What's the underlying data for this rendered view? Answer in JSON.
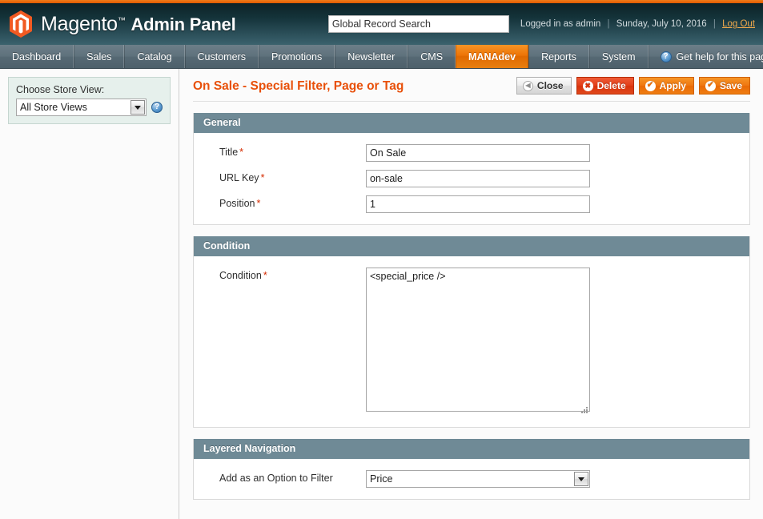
{
  "brand": {
    "logo_icon": "magento-hexagon-logo-icon",
    "name_light": "Magento",
    "trademark": "™",
    "name_bold": "Admin Panel",
    "accent_orange": "#e96300",
    "header_dark": "#14333a"
  },
  "header": {
    "search_placeholder": "Global Record Search",
    "search_value": "Global Record Search",
    "logged_in_as": "Logged in as admin",
    "separator": "|",
    "date": "Sunday, July 10, 2016",
    "logout_label": "Log Out"
  },
  "nav": {
    "items": [
      {
        "label": "Dashboard",
        "active": false
      },
      {
        "label": "Sales",
        "active": false
      },
      {
        "label": "Catalog",
        "active": false
      },
      {
        "label": "Customers",
        "active": false
      },
      {
        "label": "Promotions",
        "active": false
      },
      {
        "label": "Newsletter",
        "active": false
      },
      {
        "label": "CMS",
        "active": false
      },
      {
        "label": "MANAdev",
        "active": true
      },
      {
        "label": "Reports",
        "active": false
      },
      {
        "label": "System",
        "active": false
      }
    ],
    "help_icon": "help-circle-icon",
    "help_label": "Get help for this page"
  },
  "sidebar": {
    "store_switcher": {
      "label": "Choose Store View:",
      "selected": "All Store Views",
      "help_icon": "help-circle-icon"
    }
  },
  "content": {
    "page_title": "On Sale - Special Filter, Page or Tag",
    "buttons": [
      {
        "label": "Close",
        "style": "gray",
        "icon": "back-arrow-circle-icon"
      },
      {
        "label": "Delete",
        "style": "red",
        "icon": "x-circle-icon"
      },
      {
        "label": "Apply",
        "style": "orange",
        "icon": "check-circle-icon"
      },
      {
        "label": "Save",
        "style": "orange",
        "icon": "check-circle-icon"
      }
    ],
    "fieldsets": [
      {
        "legend": "General",
        "fields": [
          {
            "label": "Title",
            "required": true,
            "type": "text",
            "value": "On Sale"
          },
          {
            "label": "URL Key",
            "required": true,
            "type": "text",
            "value": "on-sale"
          },
          {
            "label": "Position",
            "required": true,
            "type": "text",
            "value": "1"
          }
        ]
      },
      {
        "legend": "Condition",
        "fields": [
          {
            "label": "Condition",
            "required": true,
            "type": "textarea",
            "value": "<special_price />"
          }
        ]
      },
      {
        "legend": "Layered Navigation",
        "fields": [
          {
            "label": "Add as an Option to Filter",
            "required": false,
            "type": "select",
            "value": "Price"
          }
        ]
      }
    ]
  }
}
